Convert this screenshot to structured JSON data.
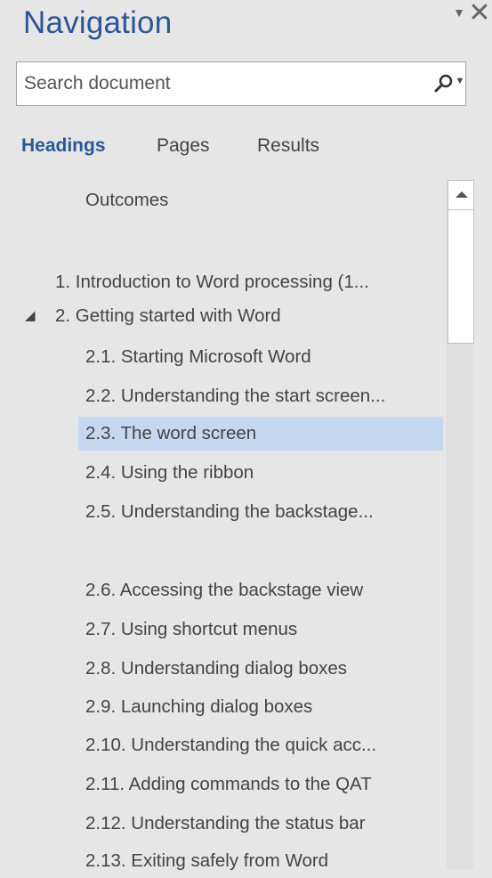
{
  "pane": {
    "title": "Navigation",
    "menu_glyph": "▼",
    "close_glyph": "✕"
  },
  "search": {
    "placeholder": "Search document",
    "value": "",
    "icon": "search-icon",
    "dropdown_glyph": "▼"
  },
  "tabs": [
    {
      "label": "Headings",
      "active": true
    },
    {
      "label": "Pages",
      "active": false
    },
    {
      "label": "Results",
      "active": false
    }
  ],
  "headings": [
    {
      "label": "Outcomes",
      "level": 2
    },
    {
      "label": "1. Introduction to Word processing (1...",
      "level": 1
    },
    {
      "label": "2. Getting started with Word",
      "level": 1,
      "expanded": true
    },
    {
      "label": "2.1. Starting Microsoft Word",
      "level": 2
    },
    {
      "label": "2.2. Understanding the start screen...",
      "level": 2
    },
    {
      "label": "2.3. The word screen",
      "level": 2,
      "selected": true
    },
    {
      "label": "2.4. Using the ribbon",
      "level": 2
    },
    {
      "label": "2.5. Understanding the backstage...",
      "level": 2
    },
    {
      "label": "2.6. Accessing the backstage view",
      "level": 2
    },
    {
      "label": "2.7. Using shortcut menus",
      "level": 2
    },
    {
      "label": "2.8. Understanding dialog boxes",
      "level": 2
    },
    {
      "label": "2.9. Launching dialog boxes",
      "level": 2
    },
    {
      "label": "2.10. Understanding the quick acc...",
      "level": 2
    },
    {
      "label": "2.11. Adding commands to the QAT",
      "level": 2
    },
    {
      "label": "2.12. Understanding the status bar",
      "level": 2
    },
    {
      "label": "2.13. Exiting safely from Word",
      "level": 2
    }
  ],
  "expander_glyph": "◢",
  "colors": {
    "accent": "#2b579a",
    "selected_bg": "#c5d8f2",
    "pane_bg": "#e6e6e6"
  }
}
